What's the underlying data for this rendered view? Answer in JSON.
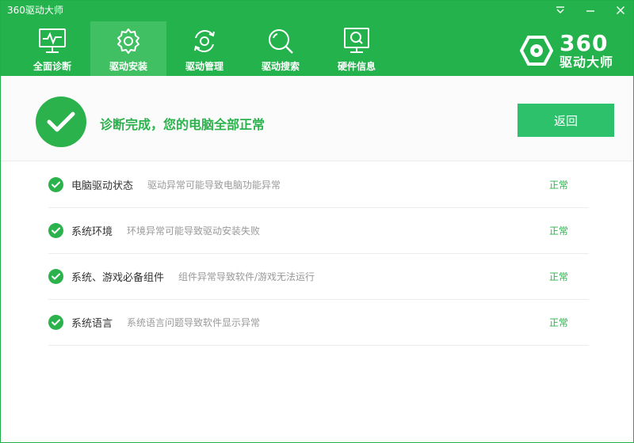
{
  "window": {
    "title": "360驱动大师"
  },
  "colors": {
    "brand": "#23b24b",
    "active_tab": "#41c063",
    "button": "#2ec16b",
    "ok_text": "#2bb24c"
  },
  "nav": {
    "items": [
      {
        "label": "全面诊断",
        "icon": "monitor-pulse-icon"
      },
      {
        "label": "驱动安装",
        "icon": "gear-icon",
        "active": true
      },
      {
        "label": "驱动管理",
        "icon": "refresh-gear-icon"
      },
      {
        "label": "驱动搜索",
        "icon": "search-icon"
      },
      {
        "label": "硬件信息",
        "icon": "hardware-info-icon"
      }
    ]
  },
  "logo": {
    "number": "360",
    "name": "驱动大师"
  },
  "status": {
    "message": "诊断完成，您的电脑全部正常",
    "back_label": "返回"
  },
  "rows": [
    {
      "title": "电脑驱动状态",
      "desc": "驱动异常可能导致电脑功能异常",
      "status": "正常"
    },
    {
      "title": "系统环境",
      "desc": "环境异常可能导致驱动安装失败",
      "status": "正常"
    },
    {
      "title": "系统、游戏必备组件",
      "desc": "组件异常导致软件/游戏无法运行",
      "status": "正常"
    },
    {
      "title": "系统语言",
      "desc": "系统语言问题导致软件显示异常",
      "status": "正常"
    }
  ]
}
